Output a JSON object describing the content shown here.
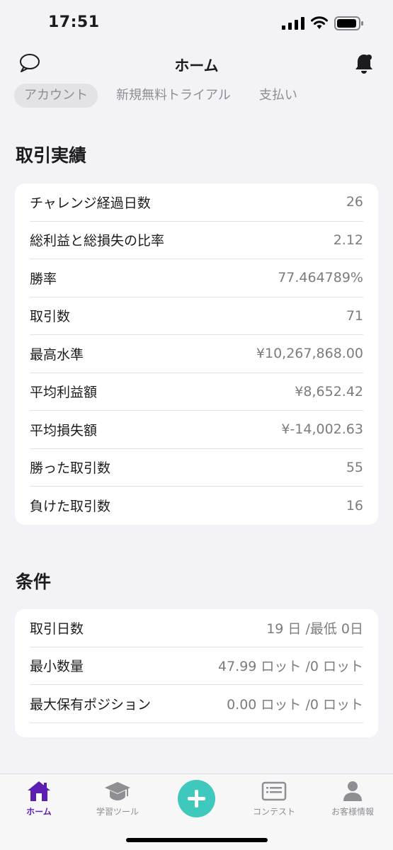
{
  "status_bar": {
    "time": "17:51"
  },
  "nav": {
    "title": "ホーム"
  },
  "tabs": [
    {
      "label": "アカウント",
      "active": true
    },
    {
      "label": "新規無料トライアル",
      "active": false
    },
    {
      "label": "支払い",
      "active": false
    }
  ],
  "performance": {
    "title": "取引実績",
    "rows": [
      {
        "label": "チャレンジ経過日数",
        "value": "26"
      },
      {
        "label": "総利益と総損失の比率",
        "value": "2.12"
      },
      {
        "label": "勝率",
        "value": "77.464789%"
      },
      {
        "label": "取引数",
        "value": "71"
      },
      {
        "label": "最高水準",
        "value": "¥10,267,868.00"
      },
      {
        "label": "平均利益額",
        "value": "¥8,652.42"
      },
      {
        "label": "平均損失額",
        "value": "¥-14,002.63"
      },
      {
        "label": "勝った取引数",
        "value": "55"
      },
      {
        "label": "負けた取引数",
        "value": "16"
      }
    ]
  },
  "conditions": {
    "title": "条件",
    "rows": [
      {
        "label": "取引日数",
        "value": "19 日 /最低 0日"
      },
      {
        "label": "最小数量",
        "value": "47.99 ロット /0 ロット"
      },
      {
        "label": "最大保有ポジション",
        "value": "0.00 ロット /0 ロット"
      }
    ]
  },
  "tabbar": {
    "home": "ホーム",
    "learn": "学習ツール",
    "contest": "コンテスト",
    "profile": "お客様情報"
  },
  "colors": {
    "accent": "#5b1eb3",
    "add": "#3fc9bd"
  }
}
